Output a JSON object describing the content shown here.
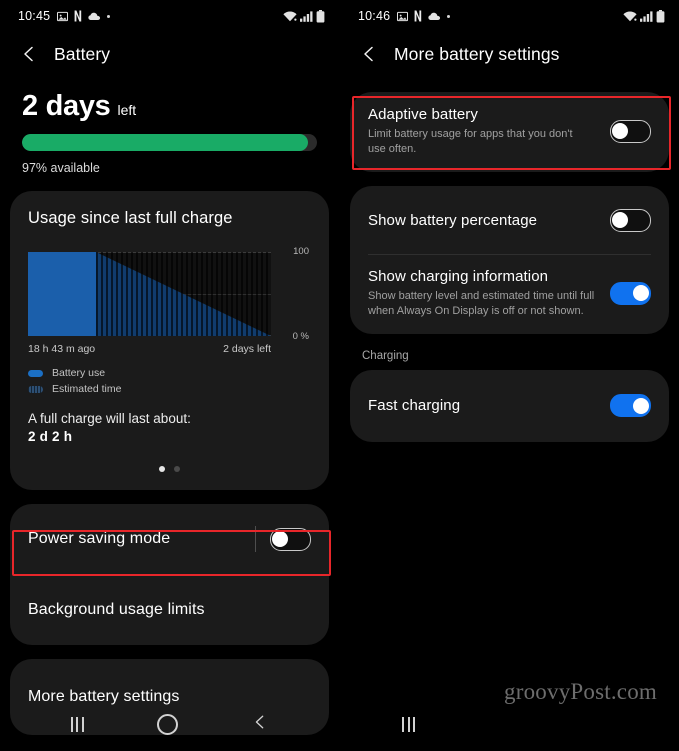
{
  "left": {
    "status_bar": {
      "time": "10:45",
      "left_icons": [
        "image-icon",
        "netflix-n-icon",
        "cloud-icon",
        "dot-icon"
      ],
      "right_icons": [
        "wifi-icon",
        "signal-icon",
        "battery-icon"
      ]
    },
    "title": "Battery",
    "back_icon": "chevron-left-icon",
    "hero": {
      "value": "2 days",
      "suffix": "left",
      "percent_label": "97% available",
      "battery_percent": 97,
      "fill_color": "#19ab66"
    },
    "usage_card": {
      "title": "Usage since last full charge",
      "chart": {
        "y_top_label": "100",
        "y_bottom_label": "0 %",
        "x_left_label": "18 h 43 m ago",
        "x_right_label": "2 days left"
      },
      "legend": [
        {
          "label": "Battery use",
          "style": "solid",
          "color": "#1b6fc4"
        },
        {
          "label": "Estimated time",
          "style": "striped",
          "color": "#2d4f73"
        }
      ],
      "full_charge_label": "A full charge will last about:",
      "full_charge_value": "2 d 2 h",
      "page_dots": {
        "count": 2,
        "active": 0
      }
    },
    "rows": [
      {
        "title": "Power saving mode",
        "toggle": "off",
        "highlighted": true,
        "has_separator": true
      },
      {
        "title": "Background usage limits",
        "toggle": null,
        "highlighted": false
      }
    ],
    "more_row": {
      "title": "More battery settings"
    },
    "navbar": [
      "recents-icon",
      "home-icon",
      "back-icon"
    ]
  },
  "right": {
    "status_bar": {
      "time": "10:46",
      "left_icons": [
        "image-icon",
        "netflix-n-icon",
        "cloud-icon",
        "dot-icon"
      ],
      "right_icons": [
        "wifi-icon",
        "signal-icon",
        "battery-icon"
      ]
    },
    "title": "More battery settings",
    "back_icon": "chevron-left-icon",
    "rows": [
      {
        "title": "Adaptive battery",
        "subtitle": "Limit battery usage for apps that you don't use often.",
        "toggle": "off",
        "highlighted": true
      },
      {
        "title": "Show battery percentage",
        "subtitle": "",
        "toggle": "off",
        "highlighted": false
      },
      {
        "title": "Show charging information",
        "subtitle": "Show battery level and estimated time until full when Always On Display is off or not shown.",
        "toggle": "on",
        "highlighted": false
      }
    ],
    "section_label": "Charging",
    "charging_rows": [
      {
        "title": "Fast charging",
        "toggle": "on"
      }
    ],
    "watermark": "groovyPost.com",
    "navbar": [
      "recents-icon"
    ]
  },
  "chart_data": {
    "type": "area",
    "title": "Usage since last full charge",
    "xlabel": "",
    "ylabel": "",
    "ylim": [
      0,
      100
    ],
    "y_ticks": [
      0,
      50,
      100
    ],
    "y_tick_labels": [
      "0 %",
      "",
      "100"
    ],
    "x_range_labels": [
      "18 h 43 m ago",
      "2 days left"
    ],
    "grid": true,
    "legend_position": "below",
    "series": [
      {
        "name": "Battery use",
        "style": "solid",
        "color": "#1b5fab",
        "x": [
          0,
          28
        ],
        "values": [
          100,
          100
        ]
      },
      {
        "name": "Estimated time",
        "style": "striped",
        "color": "#2d4f73",
        "x": [
          28,
          100
        ],
        "values": [
          100,
          0
        ]
      }
    ]
  }
}
